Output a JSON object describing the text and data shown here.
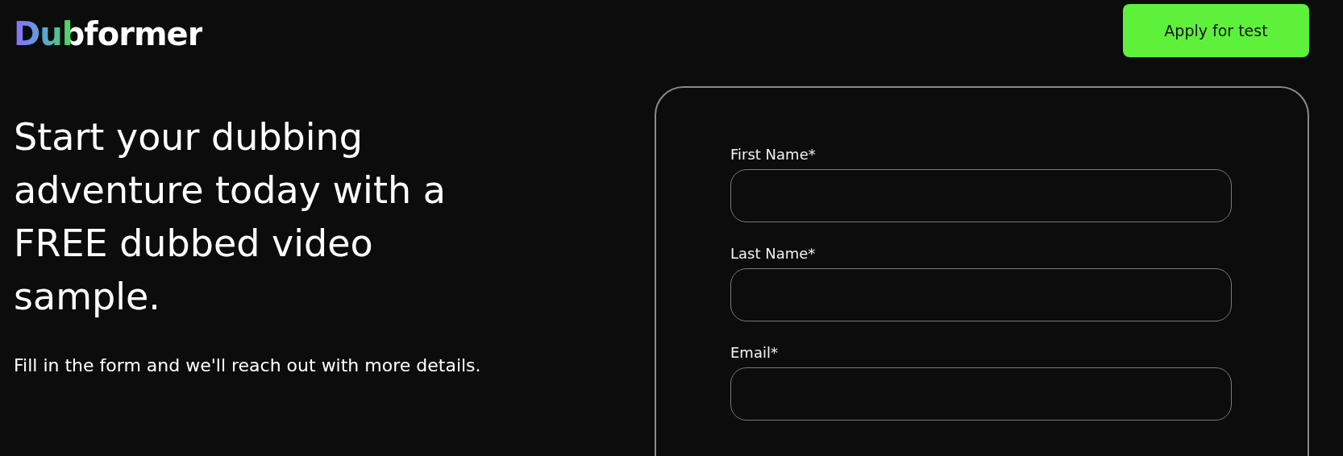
{
  "header": {
    "logo": "Dubformer",
    "button": "Apply for test"
  },
  "hero": {
    "heading": "Start your dubbing adventure today with a FREE dubbed video sample.",
    "text": "Fill in the form and we'll reach out with more details."
  },
  "form": {
    "fields": [
      {
        "label": "First Name*"
      },
      {
        "label": "Last Name*"
      },
      {
        "label": "Email*"
      }
    ]
  }
}
